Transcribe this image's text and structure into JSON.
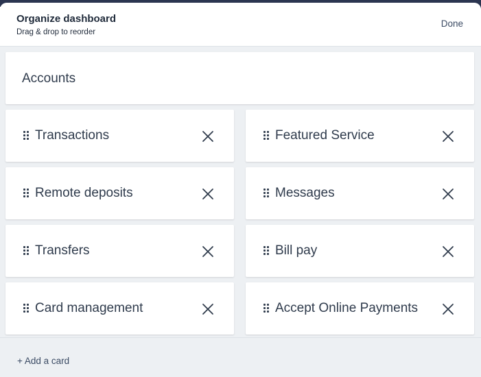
{
  "header": {
    "title": "Organize dashboard",
    "subtitle": "Drag & drop to reorder",
    "done_label": "Done"
  },
  "full_card": {
    "label": "Accounts"
  },
  "cards": [
    {
      "label": "Transactions"
    },
    {
      "label": "Featured Service"
    },
    {
      "label": "Remote deposits"
    },
    {
      "label": "Messages"
    },
    {
      "label": "Transfers"
    },
    {
      "label": "Bill pay"
    },
    {
      "label": "Card management"
    },
    {
      "label": "Accept Online Payments"
    }
  ],
  "footer": {
    "add_card_label": "+ Add a card"
  },
  "icons": {
    "drag": "drag-handle-icon",
    "remove": "close-icon"
  },
  "colors": {
    "text": "#2f3b4c",
    "background": "#edf0f3",
    "card": "#ffffff",
    "backdrop": "#2b3550"
  }
}
